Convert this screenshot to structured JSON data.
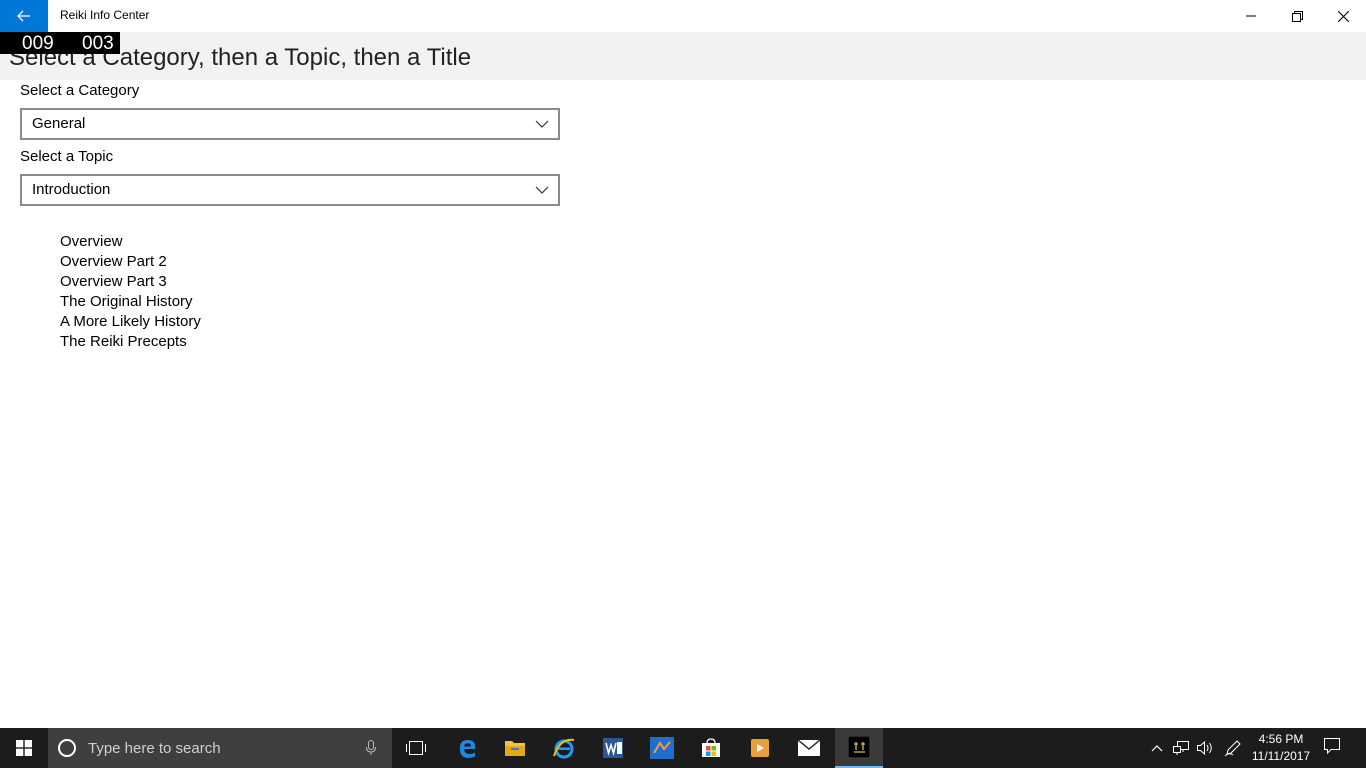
{
  "window": {
    "title": "Reiki Info Center",
    "accent_color": "#0078d7",
    "controls": [
      "minimize-icon",
      "restore-icon",
      "close-icon"
    ]
  },
  "counter": {
    "left": "009",
    "right": "003"
  },
  "header": {
    "heading": "Select a Category, then a Topic, then a Title"
  },
  "category": {
    "label": "Select a Category",
    "value": "General"
  },
  "topic": {
    "label": "Select a Topic",
    "value": "Introduction"
  },
  "titles": [
    "Overview",
    "Overview Part 2",
    "Overview Part 3",
    "The Original History",
    "A More Likely History",
    "The Reiki Precepts"
  ],
  "taskbar": {
    "search_placeholder": "Type here to search",
    "apps": [
      "task-view-icon",
      "edge-icon",
      "file-explorer-icon",
      "internet-explorer-icon",
      "word-icon",
      "app-icon",
      "store-icon",
      "media-player-icon",
      "mail-icon",
      "reiki-app-icon"
    ],
    "clock_time": "4:56 PM",
    "clock_date": "11/11/2017"
  }
}
